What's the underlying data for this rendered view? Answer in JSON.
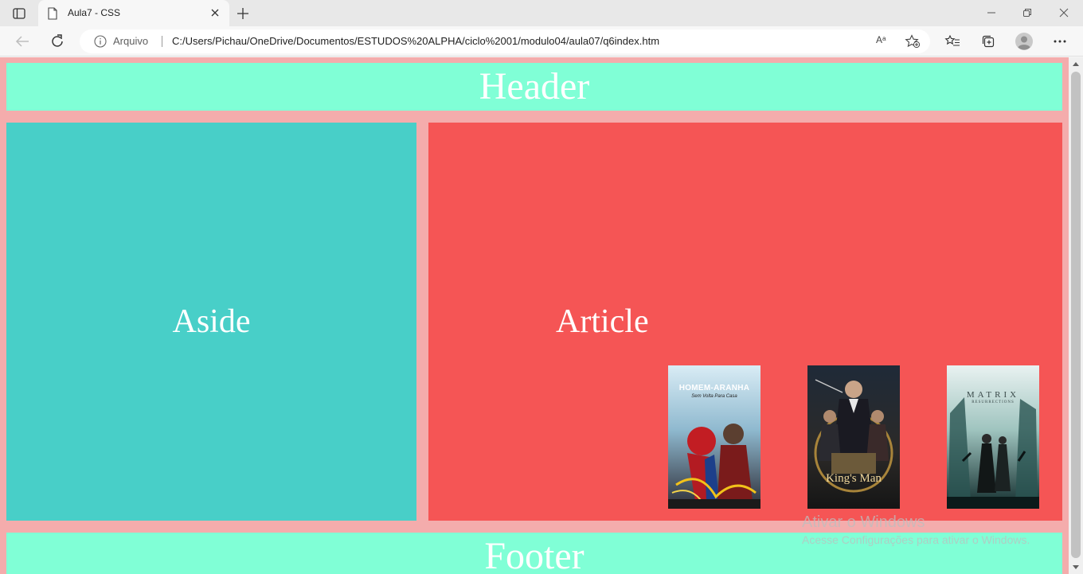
{
  "browser": {
    "tab": {
      "title": "Aula7 - CSS"
    },
    "address": {
      "security_label": "Arquivo",
      "url": "C:/Users/Pichau/OneDrive/Documentos/ESTUDOS%20ALPHA/ciclo%2001/modulo04/aula07/q6index.htm",
      "read_aloud_label": "Aᵃ"
    }
  },
  "page": {
    "header": "Header",
    "aside": "Aside",
    "article": "Article",
    "footer": "Footer",
    "posters": [
      {
        "name": "homem-aranha-poster",
        "title": "HOMEM-ARANHA",
        "subtitle": "Sem Volta Para Casa"
      },
      {
        "name": "kings-man-poster",
        "title": "King's Man"
      },
      {
        "name": "matrix-poster",
        "title": "MATRIX",
        "subtitle": "RESURRECTIONS"
      }
    ]
  },
  "watermark": {
    "title": "Ativar o Windows",
    "subtitle": "Acesse Configurações para ativar o Windows."
  },
  "colors": {
    "page_bg": "#f4acac",
    "header_footer": "#80ffd6",
    "aside": "#48cfc8",
    "article": "#f55555"
  },
  "icons": [
    "tab-actions-icon",
    "page-icon",
    "close-icon",
    "plus-icon",
    "minimize-icon",
    "restore-icon",
    "back-icon",
    "refresh-icon",
    "info-icon",
    "read-aloud-icon",
    "add-favorite-icon",
    "favorites-icon",
    "collections-icon",
    "profile-icon",
    "more-icon"
  ]
}
